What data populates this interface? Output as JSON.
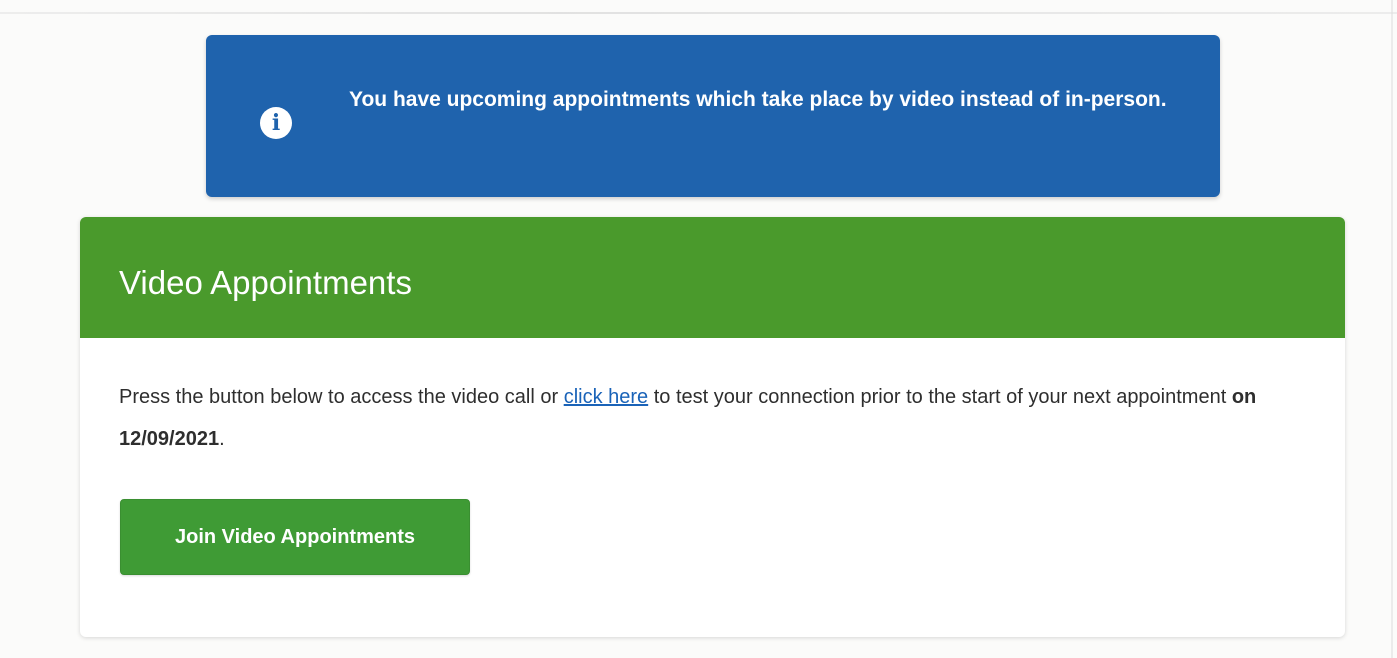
{
  "notice": {
    "icon": "info-icon",
    "message": "You have upcoming appointments which take place by video instead of in-person.",
    "background_color": "#1f63ad"
  },
  "video_card": {
    "title": "Video Appointments",
    "header_color": "#4a9a2c",
    "body_prefix": "Press the button below to access the video call or ",
    "link_text": "click here",
    "body_middle": " to test your connection prior to the start of your next appointment ",
    "date_text": "on 12/09/2021",
    "body_suffix": ".",
    "join_button_label": "Join Video Appointments",
    "button_color": "#3f9b35"
  }
}
